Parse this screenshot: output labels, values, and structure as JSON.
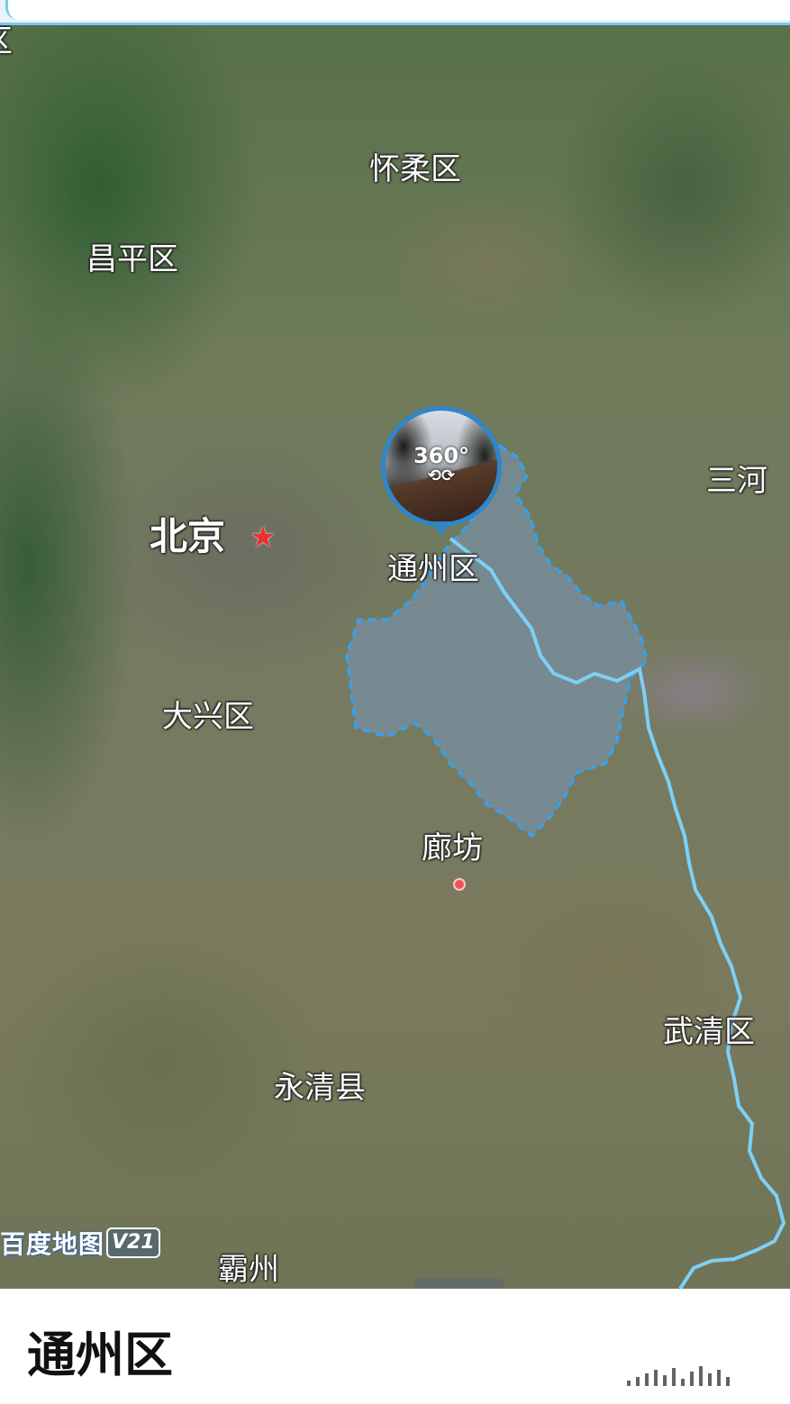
{
  "map": {
    "labels": {
      "huairou": "怀柔区",
      "changping": "昌平区",
      "beijing": "北京",
      "tongzhou": "通州区",
      "sanhe": "三河",
      "daxing": "大兴区",
      "langfang": "廊坊",
      "wuqing": "武清区",
      "yongqing": "永清县",
      "bazhou": "霸州",
      "edge_fragment": "区"
    },
    "pano_badge": "360°",
    "pano_badge_icon": "pano-360-icon",
    "watermark": {
      "brand": "百度地图",
      "version": "V21"
    },
    "colors": {
      "boundary": "#3aa0e8",
      "river": "#7dd0f5",
      "capital_star": "#ee2e2e",
      "city_dot": "#f0545a"
    }
  },
  "sheet": {
    "title": "通州区"
  }
}
